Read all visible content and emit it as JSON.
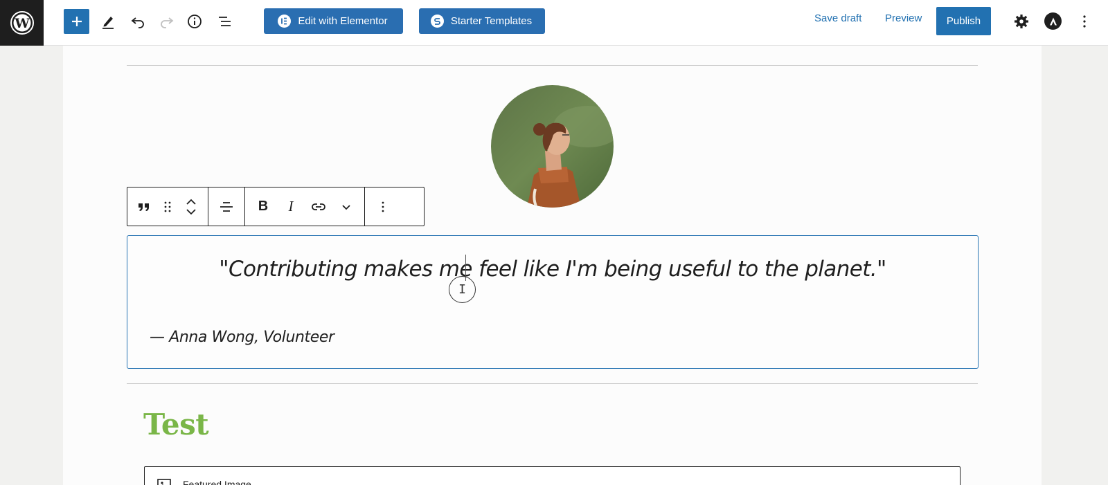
{
  "toolbar": {
    "elementor_label": "Edit with Elementor",
    "starter_templates_label": "Starter Templates",
    "save_draft_label": "Save draft",
    "preview_label": "Preview",
    "publish_label": "Publish"
  },
  "block": {
    "quote": "\"Contributing makes me feel like I'm being useful to the planet.\"",
    "citation": "— Anna Wong, Volunteer"
  },
  "content": {
    "heading": "Test",
    "featured_image_label": "Featured Image"
  },
  "colors": {
    "accent": "#2271b1",
    "heading_green": "#7ab648",
    "toolbar_dark": "#1e1e1e"
  }
}
